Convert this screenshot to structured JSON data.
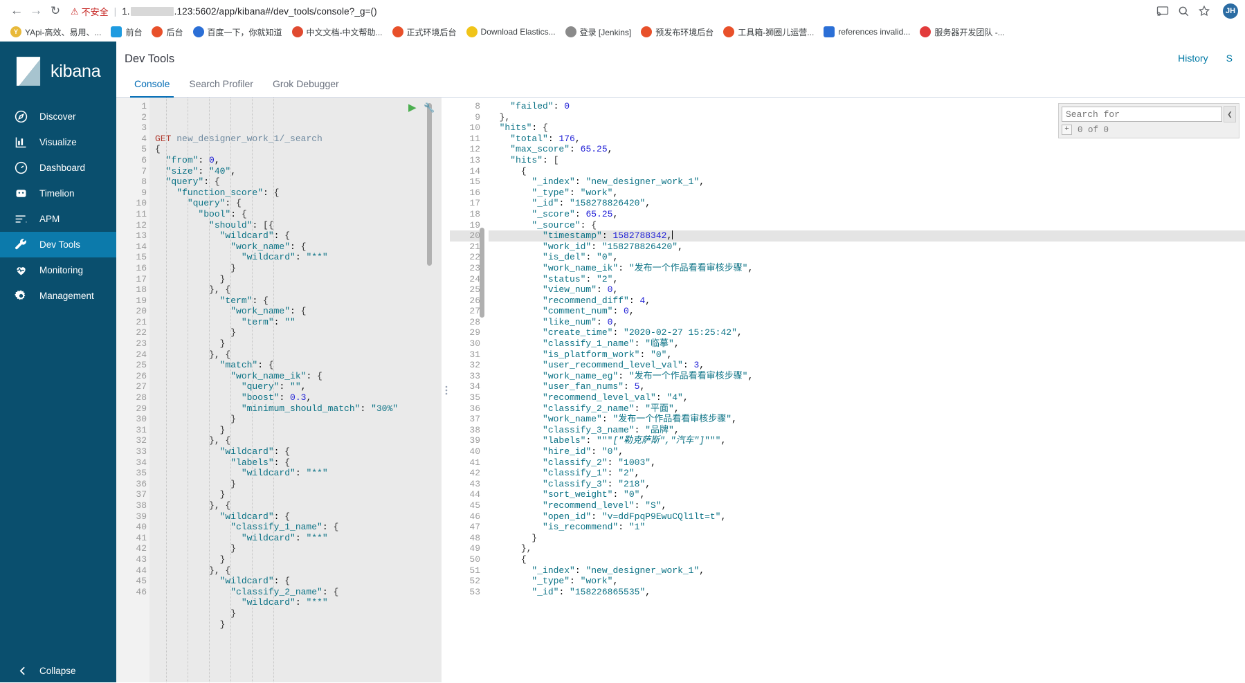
{
  "browser": {
    "back_icon": "arrow-left-icon",
    "forward_icon": "arrow-right-icon",
    "reload_icon": "reload-icon",
    "security_label": "不安全",
    "url_prefix": "1.",
    "url_suffix": ".123:5602/app/kibana#/dev_tools/console?_g=()",
    "profile_initial": "JH",
    "right_icons": [
      "cast-icon",
      "zoom-icon",
      "star-icon"
    ],
    "bookmarks": [
      {
        "label": "YApi-高效、易用、...",
        "color": "#e8b93a",
        "glyph": "Y",
        "shape": "round"
      },
      {
        "label": "前台",
        "color": "#1e9be0",
        "glyph": "",
        "shape": "square"
      },
      {
        "label": "后台",
        "color": "#e8502a",
        "glyph": "",
        "shape": "round"
      },
      {
        "label": "百度一下，你就知道",
        "color": "#2b6fd6",
        "glyph": "",
        "shape": "round"
      },
      {
        "label": "中文文档-中文帮助...",
        "color": "#e04a30",
        "glyph": "",
        "shape": "round"
      },
      {
        "label": "正式环境后台",
        "color": "#e8502a",
        "glyph": "",
        "shape": "round"
      },
      {
        "label": "Download Elastics...",
        "color": "#f0c419",
        "glyph": "",
        "shape": "round"
      },
      {
        "label": "登录 [Jenkins]",
        "color": "#8a8a8a",
        "glyph": "",
        "shape": "round"
      },
      {
        "label": "预发布环境后台",
        "color": "#e8502a",
        "glyph": "",
        "shape": "round"
      },
      {
        "label": "工具箱-狮圈儿运营...",
        "color": "#e8502a",
        "glyph": "",
        "shape": "round"
      },
      {
        "label": "references invalid...",
        "color": "#2b6fd6",
        "glyph": "",
        "shape": "square"
      },
      {
        "label": "服务器开发团队 -...",
        "color": "#e23b3b",
        "glyph": "",
        "shape": "round"
      }
    ]
  },
  "sidebar": {
    "brand": "kibana",
    "collapse_label": "Collapse",
    "items": [
      {
        "label": "Discover",
        "icon": "compass-icon",
        "active": false
      },
      {
        "label": "Visualize",
        "icon": "bar-chart-icon",
        "active": false
      },
      {
        "label": "Dashboard",
        "icon": "dashboard-icon",
        "active": false
      },
      {
        "label": "Timelion",
        "icon": "timelion-icon",
        "active": false
      },
      {
        "label": "APM",
        "icon": "apm-icon",
        "active": false
      },
      {
        "label": "Dev Tools",
        "icon": "wrench-icon",
        "active": true
      },
      {
        "label": "Monitoring",
        "icon": "heartbeat-icon",
        "active": false
      },
      {
        "label": "Management",
        "icon": "gear-icon",
        "active": false
      }
    ]
  },
  "header": {
    "title": "Dev Tools",
    "history_label": "History",
    "settings_label": "S"
  },
  "tabs": [
    {
      "label": "Console",
      "active": true
    },
    {
      "label": "Search Profiler",
      "active": false
    },
    {
      "label": "Grok Debugger",
      "active": false
    }
  ],
  "console": {
    "play_icon": "play-icon",
    "wrench_icon": "wrench-icon",
    "divider_icon": "drag-handle-icon",
    "request_lines": [
      {
        "n": 1,
        "fold": "",
        "html": "<span class='t-method'>GET</span> <span class='t-url'>new_designer_work_1/_search</span>"
      },
      {
        "n": 2,
        "fold": "▾",
        "html": "<span class='t-brace'>{</span>"
      },
      {
        "n": 3,
        "fold": "",
        "html": "  <span class='t-key'>\"from\"</span>: <span class='t-num'>0</span>,"
      },
      {
        "n": 4,
        "fold": "",
        "html": "  <span class='t-key'>\"size\"</span>: <span class='t-string'>\"40\"</span>,"
      },
      {
        "n": 5,
        "fold": "▾",
        "html": "  <span class='t-key'>\"query\"</span>: <span class='t-brace'>{</span>"
      },
      {
        "n": 6,
        "fold": "▾",
        "html": "    <span class='t-key'>\"function_score\"</span>: <span class='t-brace'>{</span>"
      },
      {
        "n": 7,
        "fold": "▾",
        "html": "      <span class='t-key'>\"query\"</span>: <span class='t-brace'>{</span>"
      },
      {
        "n": 8,
        "fold": "▾",
        "html": "        <span class='t-key'>\"bool\"</span>: <span class='t-brace'>{</span>"
      },
      {
        "n": 9,
        "fold": "▾",
        "html": "          <span class='t-key'>\"should\"</span>: <span class='t-brace'>[{</span>"
      },
      {
        "n": 10,
        "fold": "▾",
        "html": "            <span class='t-key'>\"wildcard\"</span>: <span class='t-brace'>{</span>"
      },
      {
        "n": 11,
        "fold": "▾",
        "html": "              <span class='t-key'>\"work_name\"</span>: <span class='t-brace'>{</span>"
      },
      {
        "n": 12,
        "fold": "",
        "html": "                <span class='t-key'>\"wildcard\"</span>: <span class='t-string'>\"**\"</span>"
      },
      {
        "n": 13,
        "fold": "▴",
        "html": "              <span class='t-brace'>}</span>"
      },
      {
        "n": 14,
        "fold": "▴",
        "html": "            <span class='t-brace'>}</span>"
      },
      {
        "n": 15,
        "fold": "▾",
        "html": "          <span class='t-brace'>}, {</span>"
      },
      {
        "n": 16,
        "fold": "▾",
        "html": "            <span class='t-key'>\"term\"</span>: <span class='t-brace'>{</span>"
      },
      {
        "n": 17,
        "fold": "▾",
        "html": "              <span class='t-key'>\"work_name\"</span>: <span class='t-brace'>{</span>"
      },
      {
        "n": 18,
        "fold": "",
        "html": "                <span class='t-key'>\"term\"</span>: <span class='t-string'>\"\"</span>"
      },
      {
        "n": 19,
        "fold": "▴",
        "html": "              <span class='t-brace'>}</span>"
      },
      {
        "n": 20,
        "fold": "▴",
        "html": "            <span class='t-brace'>}</span>"
      },
      {
        "n": 21,
        "fold": "▾",
        "html": "          <span class='t-brace'>}, {</span>"
      },
      {
        "n": 22,
        "fold": "▾",
        "html": "            <span class='t-key'>\"match\"</span>: <span class='t-brace'>{</span>"
      },
      {
        "n": 23,
        "fold": "▾",
        "html": "              <span class='t-key'>\"work_name_ik\"</span>: <span class='t-brace'>{</span>"
      },
      {
        "n": 24,
        "fold": "",
        "html": "                <span class='t-key'>\"query\"</span>: <span class='t-string'>\"\"</span>,"
      },
      {
        "n": 25,
        "fold": "",
        "html": "                <span class='t-key'>\"boost\"</span>: <span class='t-num'>0.3</span>,"
      },
      {
        "n": 26,
        "fold": "",
        "html": "                <span class='t-key'>\"minimum_should_match\"</span>: <span class='t-string'>\"30%\"</span>"
      },
      {
        "n": 27,
        "fold": "▴",
        "html": "              <span class='t-brace'>}</span>"
      },
      {
        "n": 28,
        "fold": "▴",
        "html": "            <span class='t-brace'>}</span>"
      },
      {
        "n": 29,
        "fold": "▾",
        "html": "          <span class='t-brace'>}, {</span>"
      },
      {
        "n": 30,
        "fold": "▾",
        "html": "            <span class='t-key'>\"wildcard\"</span>: <span class='t-brace'>{</span>"
      },
      {
        "n": 31,
        "fold": "▾",
        "html": "              <span class='t-key'>\"labels\"</span>: <span class='t-brace'>{</span>"
      },
      {
        "n": 32,
        "fold": "",
        "html": "                <span class='t-key'>\"wildcard\"</span>: <span class='t-string'>\"**\"</span>"
      },
      {
        "n": 33,
        "fold": "▴",
        "html": "              <span class='t-brace'>}</span>"
      },
      {
        "n": 34,
        "fold": "▴",
        "html": "            <span class='t-brace'>}</span>"
      },
      {
        "n": 35,
        "fold": "▾",
        "html": "          <span class='t-brace'>}, {</span>"
      },
      {
        "n": 36,
        "fold": "▾",
        "html": "            <span class='t-key'>\"wildcard\"</span>: <span class='t-brace'>{</span>"
      },
      {
        "n": 37,
        "fold": "▾",
        "html": "              <span class='t-key'>\"classify_1_name\"</span>: <span class='t-brace'>{</span>"
      },
      {
        "n": 38,
        "fold": "",
        "html": "                <span class='t-key'>\"wildcard\"</span>: <span class='t-string'>\"**\"</span>"
      },
      {
        "n": 39,
        "fold": "▴",
        "html": "              <span class='t-brace'>}</span>"
      },
      {
        "n": 40,
        "fold": "▴",
        "html": "            <span class='t-brace'>}</span>"
      },
      {
        "n": 41,
        "fold": "▾",
        "html": "          <span class='t-brace'>}, {</span>"
      },
      {
        "n": 42,
        "fold": "▾",
        "html": "            <span class='t-key'>\"wildcard\"</span>: <span class='t-brace'>{</span>"
      },
      {
        "n": 43,
        "fold": "▾",
        "html": "              <span class='t-key'>\"classify_2_name\"</span>: <span class='t-brace'>{</span>"
      },
      {
        "n": 44,
        "fold": "",
        "html": "                <span class='t-key'>\"wildcard\"</span>: <span class='t-string'>\"**\"</span>"
      },
      {
        "n": 45,
        "fold": "▴",
        "html": "              <span class='t-brace'>}</span>"
      },
      {
        "n": 46,
        "fold": "▴",
        "html": "            <span class='t-brace'>}</span>"
      }
    ],
    "response_lines": [
      {
        "n": 8,
        "fold": "",
        "hl": false,
        "html": "    <span class='t-key'>\"failed\"</span>: <span class='t-num'>0</span>"
      },
      {
        "n": 9,
        "fold": "▴",
        "hl": false,
        "html": "  <span class='t-brace'>},</span>"
      },
      {
        "n": 10,
        "fold": "▾",
        "hl": false,
        "html": "  <span class='t-key'>\"hits\"</span>: <span class='t-brace'>{</span>"
      },
      {
        "n": 11,
        "fold": "",
        "hl": false,
        "html": "    <span class='t-key'>\"total\"</span>: <span class='t-num'>176</span>,"
      },
      {
        "n": 12,
        "fold": "",
        "hl": false,
        "html": "    <span class='t-key'>\"max_score\"</span>: <span class='t-num'>65.25</span>,"
      },
      {
        "n": 13,
        "fold": "▾",
        "hl": false,
        "html": "    <span class='t-key'>\"hits\"</span>: <span class='t-brace'>[</span>"
      },
      {
        "n": 14,
        "fold": "▾",
        "hl": false,
        "html": "      <span class='t-brace'>{</span>"
      },
      {
        "n": 15,
        "fold": "",
        "hl": false,
        "html": "        <span class='t-key'>\"_index\"</span>: <span class='t-string'>\"new_designer_work_1\"</span>,"
      },
      {
        "n": 16,
        "fold": "",
        "hl": false,
        "html": "        <span class='t-key'>\"_type\"</span>: <span class='t-string'>\"work\"</span>,"
      },
      {
        "n": 17,
        "fold": "",
        "hl": false,
        "html": "        <span class='t-key'>\"_id\"</span>: <span class='t-string'>\"158278826420\"</span>,"
      },
      {
        "n": 18,
        "fold": "",
        "hl": false,
        "html": "        <span class='t-key'>\"_score\"</span>: <span class='t-num'>65.25</span>,"
      },
      {
        "n": 19,
        "fold": "▾",
        "hl": false,
        "html": "        <span class='t-key'>\"_source\"</span>: <span class='t-brace'>{</span>"
      },
      {
        "n": 20,
        "fold": "",
        "hl": true,
        "html": "          <span class='t-key'>\"timestamp\"</span>: <span class='t-num'>1582788342</span>,<span class='caret'></span>"
      },
      {
        "n": 21,
        "fold": "",
        "hl": false,
        "html": "          <span class='t-key'>\"work_id\"</span>: <span class='t-string'>\"158278826420\"</span>,"
      },
      {
        "n": 22,
        "fold": "",
        "hl": false,
        "html": "          <span class='t-key'>\"is_del\"</span>: <span class='t-string'>\"0\"</span>,"
      },
      {
        "n": 23,
        "fold": "",
        "hl": false,
        "html": "          <span class='t-key'>\"work_name_ik\"</span>: <span class='t-string'>\"发布一个作品看看审核步骤\"</span>,"
      },
      {
        "n": 24,
        "fold": "",
        "hl": false,
        "html": "          <span class='t-key'>\"status\"</span>: <span class='t-string'>\"2\"</span>,"
      },
      {
        "n": 25,
        "fold": "",
        "hl": false,
        "html": "          <span class='t-key'>\"view_num\"</span>: <span class='t-num'>0</span>,"
      },
      {
        "n": 26,
        "fold": "",
        "hl": false,
        "html": "          <span class='t-key'>\"recommend_diff\"</span>: <span class='t-num'>4</span>,"
      },
      {
        "n": 27,
        "fold": "",
        "hl": false,
        "html": "          <span class='t-key'>\"comment_num\"</span>: <span class='t-num'>0</span>,"
      },
      {
        "n": 28,
        "fold": "",
        "hl": false,
        "html": "          <span class='t-key'>\"like_num\"</span>: <span class='t-num'>0</span>,"
      },
      {
        "n": 29,
        "fold": "",
        "hl": false,
        "html": "          <span class='t-key'>\"create_time\"</span>: <span class='t-string'>\"2020-02-27 15:25:42\"</span>,"
      },
      {
        "n": 30,
        "fold": "",
        "hl": false,
        "html": "          <span class='t-key'>\"classify_1_name\"</span>: <span class='t-string'>\"临摹\"</span>,"
      },
      {
        "n": 31,
        "fold": "",
        "hl": false,
        "html": "          <span class='t-key'>\"is_platform_work\"</span>: <span class='t-string'>\"0\"</span>,"
      },
      {
        "n": 32,
        "fold": "",
        "hl": false,
        "html": "          <span class='t-key'>\"user_recommend_level_val\"</span>: <span class='t-num'>3</span>,"
      },
      {
        "n": 33,
        "fold": "",
        "hl": false,
        "html": "          <span class='t-key'>\"work_name_eg\"</span>: <span class='t-string'>\"发布一个作品看看审核步骤\"</span>,"
      },
      {
        "n": 34,
        "fold": "",
        "hl": false,
        "html": "          <span class='t-key'>\"user_fan_nums\"</span>: <span class='t-num'>5</span>,"
      },
      {
        "n": 35,
        "fold": "",
        "hl": false,
        "html": "          <span class='t-key'>\"recommend_level_val\"</span>: <span class='t-string'>\"4\"</span>,"
      },
      {
        "n": 36,
        "fold": "",
        "hl": false,
        "html": "          <span class='t-key'>\"classify_2_name\"</span>: <span class='t-string'>\"平面\"</span>,"
      },
      {
        "n": 37,
        "fold": "",
        "hl": false,
        "html": "          <span class='t-key'>\"work_name\"</span>: <span class='t-string'>\"发布一个作品看看审核步骤\"</span>,"
      },
      {
        "n": 38,
        "fold": "",
        "hl": false,
        "html": "          <span class='t-key'>\"classify_3_name\"</span>: <span class='t-string'>\"品牌\"</span>,"
      },
      {
        "n": 39,
        "fold": "",
        "hl": false,
        "html": "          <span class='t-key'>\"labels\"</span>: <span class='t-string'>\"\"\"</span><span class='t-italic'>[\"勒克萨斯\",\"汽车\"]</span><span class='t-string'>\"\"\"</span>,"
      },
      {
        "n": 40,
        "fold": "",
        "hl": false,
        "html": "          <span class='t-key'>\"hire_id\"</span>: <span class='t-string'>\"0\"</span>,"
      },
      {
        "n": 41,
        "fold": "",
        "hl": false,
        "html": "          <span class='t-key'>\"classify_2\"</span>: <span class='t-string'>\"1003\"</span>,"
      },
      {
        "n": 42,
        "fold": "",
        "hl": false,
        "html": "          <span class='t-key'>\"classify_1\"</span>: <span class='t-string'>\"2\"</span>,"
      },
      {
        "n": 43,
        "fold": "",
        "hl": false,
        "html": "          <span class='t-key'>\"classify_3\"</span>: <span class='t-string'>\"218\"</span>,"
      },
      {
        "n": 44,
        "fold": "",
        "hl": false,
        "html": "          <span class='t-key'>\"sort_weight\"</span>: <span class='t-string'>\"0\"</span>,"
      },
      {
        "n": 45,
        "fold": "",
        "hl": false,
        "html": "          <span class='t-key'>\"recommend_level\"</span>: <span class='t-string'>\"S\"</span>,"
      },
      {
        "n": 46,
        "fold": "",
        "hl": false,
        "html": "          <span class='t-key'>\"open_id\"</span>: <span class='t-string'>\"v=ddFpqP9EwuCQl1lt=t\"</span>,"
      },
      {
        "n": 47,
        "fold": "",
        "hl": false,
        "html": "          <span class='t-key'>\"is_recommend\"</span>: <span class='t-string'>\"1\"</span>"
      },
      {
        "n": 48,
        "fold": "▴",
        "hl": false,
        "html": "        <span class='t-brace'>}</span>"
      },
      {
        "n": 49,
        "fold": "▴",
        "hl": false,
        "html": "      <span class='t-brace'>},</span>"
      },
      {
        "n": 50,
        "fold": "▾",
        "hl": false,
        "html": "      <span class='t-brace'>{</span>"
      },
      {
        "n": 51,
        "fold": "",
        "hl": false,
        "html": "        <span class='t-key'>\"_index\"</span>: <span class='t-string'>\"new_designer_work_1\"</span>,"
      },
      {
        "n": 52,
        "fold": "",
        "hl": false,
        "html": "        <span class='t-key'>\"_type\"</span>: <span class='t-string'>\"work\"</span>,"
      },
      {
        "n": 53,
        "fold": "",
        "hl": false,
        "html": "        <span class='t-key'>\"_id\"</span>: <span class='t-string'>\"158226865535\"</span>,"
      }
    ]
  },
  "search_box": {
    "placeholder": "Search for",
    "value": "",
    "toggle_icon": "chevron-left-icon",
    "expand_icon": "plus-icon",
    "result_count": "0 of 0"
  }
}
